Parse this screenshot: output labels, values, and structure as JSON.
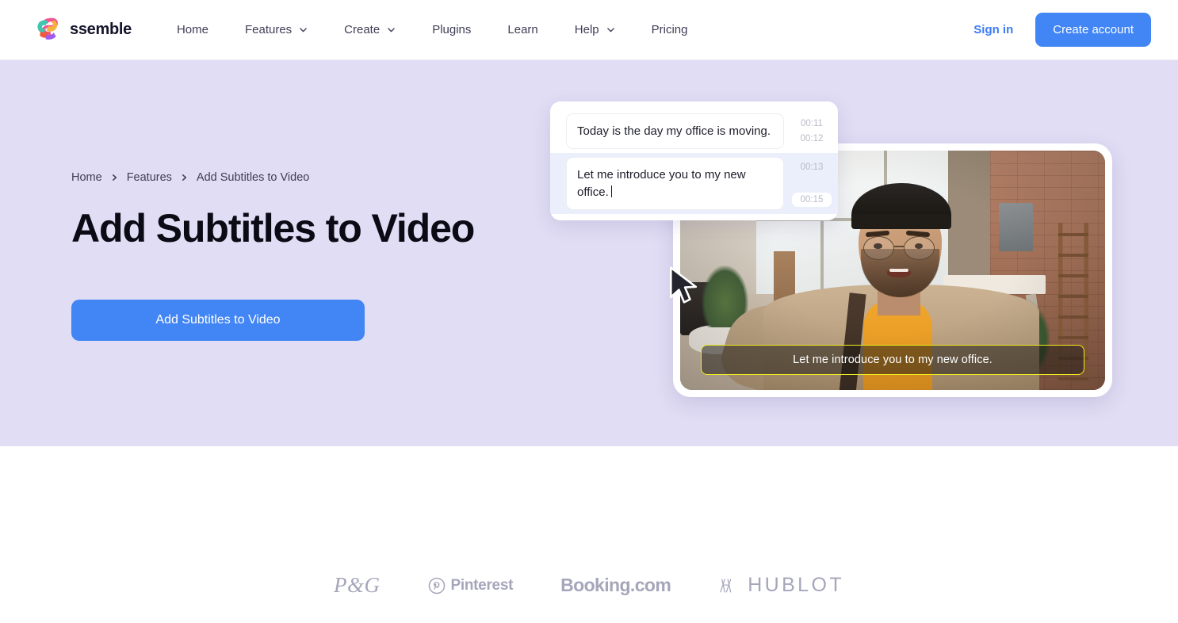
{
  "header": {
    "brand_name": "ssemble",
    "logo_icon": "ssemble-s-logo",
    "nav": [
      {
        "label": "Home",
        "has_dropdown": false,
        "icon": ""
      },
      {
        "label": "Features",
        "has_dropdown": true,
        "icon": "chevron-down-icon"
      },
      {
        "label": "Create",
        "has_dropdown": true,
        "icon": "chevron-down-icon"
      },
      {
        "label": "Plugins",
        "has_dropdown": false,
        "icon": ""
      },
      {
        "label": "Learn",
        "has_dropdown": false,
        "icon": ""
      },
      {
        "label": "Help",
        "has_dropdown": true,
        "icon": "chevron-down-icon"
      },
      {
        "label": "Pricing",
        "has_dropdown": false,
        "icon": ""
      }
    ],
    "sign_in_label": "Sign in",
    "create_account_label": "Create account"
  },
  "hero": {
    "breadcrumb": [
      {
        "label": "Home"
      },
      {
        "label": "Features"
      },
      {
        "label": "Add Subtitles to Video"
      }
    ],
    "breadcrumb_separator_icon": "chevron-right-icon",
    "title": "Add Subtitles to Video",
    "cta_label": "Add Subtitles to Video",
    "background_color": "#e1ddf4"
  },
  "editor": {
    "subtitles": [
      {
        "text": "Today is the day my office is moving.",
        "start": "00:11",
        "end": "00:12",
        "selected": false,
        "end_pill": false
      },
      {
        "text": "Let me introduce you to my new office.",
        "start": "00:13",
        "end": "00:15",
        "selected": true,
        "end_pill": true
      }
    ],
    "selected_row_color": "#eaeffb",
    "cursor_icon": "mouse-arrow-cursor"
  },
  "video": {
    "caption_text": "Let me introduce you to my new office.",
    "caption_border_color": "#f2ec1f",
    "scene_description": "man-in-beanie-selfie-in-loft-office"
  },
  "brand_logos": [
    {
      "name": "P&G",
      "icon": "pg-logo"
    },
    {
      "name": "Pinterest",
      "icon": "pinterest-logo"
    },
    {
      "name": "Booking.com",
      "icon": "booking-logo"
    },
    {
      "name": "HUBLOT",
      "icon": "hublot-logo"
    }
  ],
  "colors": {
    "accent_blue": "#4285f4",
    "link_blue": "#3b7bf6",
    "hero_lavender": "#e1ddf4",
    "logo_gray": "#a6a6bb",
    "caption_yellow": "#f2ec1f"
  }
}
